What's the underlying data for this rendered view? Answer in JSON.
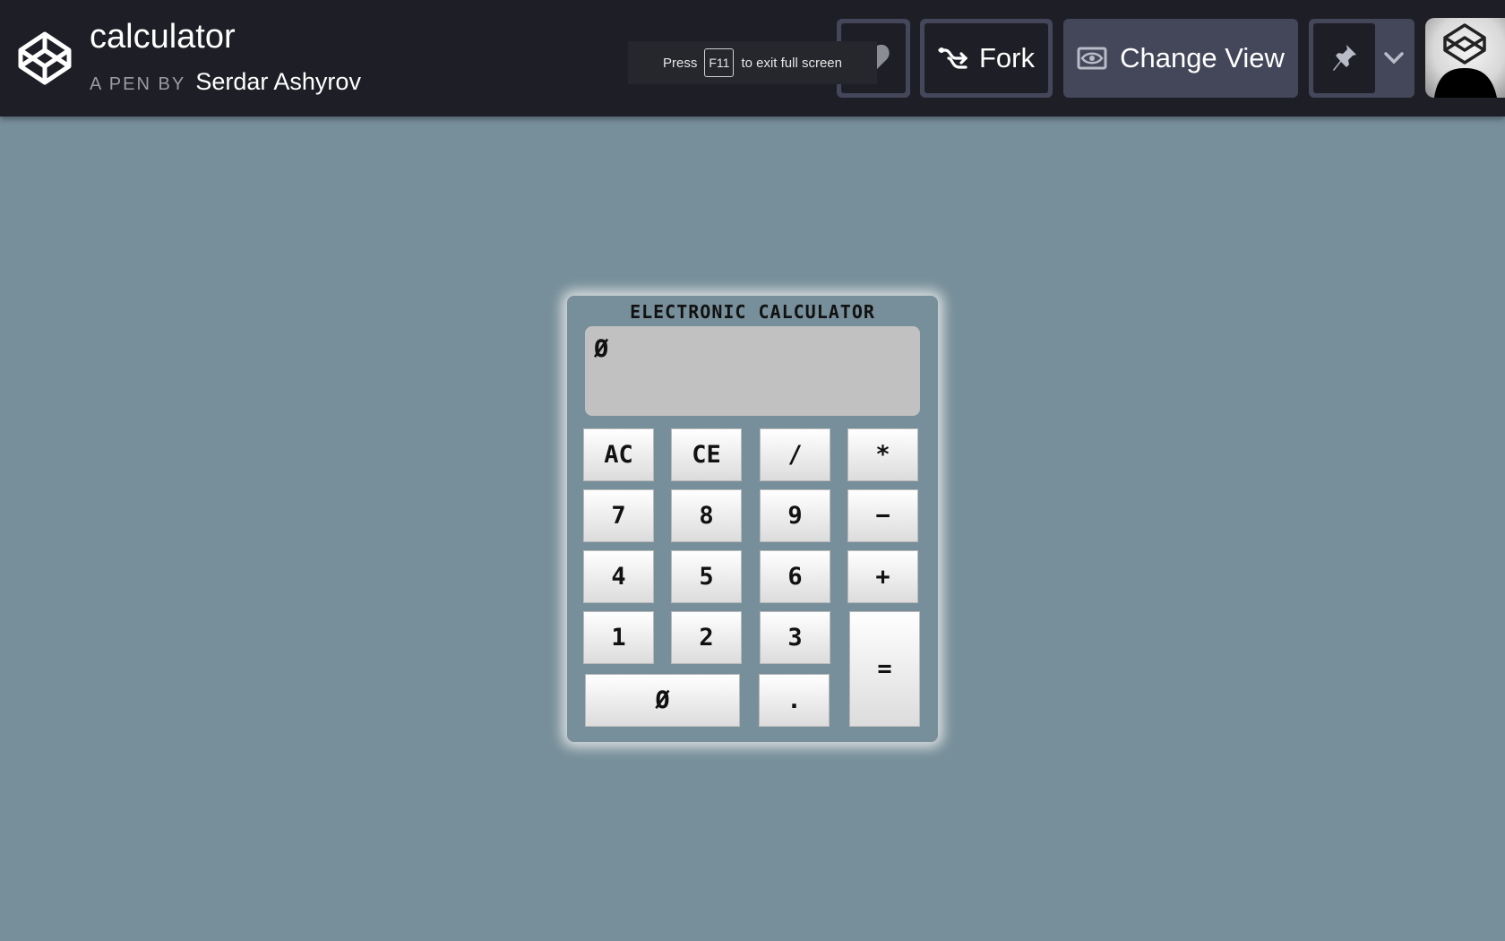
{
  "header": {
    "logo_icon": "codepen-logo-icon",
    "title": "calculator",
    "by_label": "A PEN BY",
    "author": "Serdar Ashyrov",
    "fullscreen_notice": {
      "before": "Press",
      "key": "F11",
      "after": "to exit full screen"
    },
    "heart_icon": "heart-icon",
    "fork_icon": "fork-icon",
    "fork_label": "Fork",
    "view_icon": "eye-icon",
    "change_view_label": "Change View",
    "pin_icon": "pin-icon",
    "dropdown_icon": "chevron-down-icon",
    "avatar_icon": "user-avatar"
  },
  "calculator": {
    "title": "ELECTRONIC CALCULATOR",
    "display": "Ø",
    "keys": {
      "ac": "AC",
      "ce": "CE",
      "divide": "/",
      "multiply": "*",
      "seven": "7",
      "eight": "8",
      "nine": "9",
      "minus": "−",
      "four": "4",
      "five": "5",
      "six": "6",
      "plus": "+",
      "one": "1",
      "two": "2",
      "three": "3",
      "equals": "=",
      "zero": "Ø",
      "dot": "."
    }
  },
  "colors": {
    "page_bg": "#778f9a",
    "header_bg": "#1e1f26",
    "button_bg": "#44475a",
    "display_bg": "#c1c1c1"
  }
}
